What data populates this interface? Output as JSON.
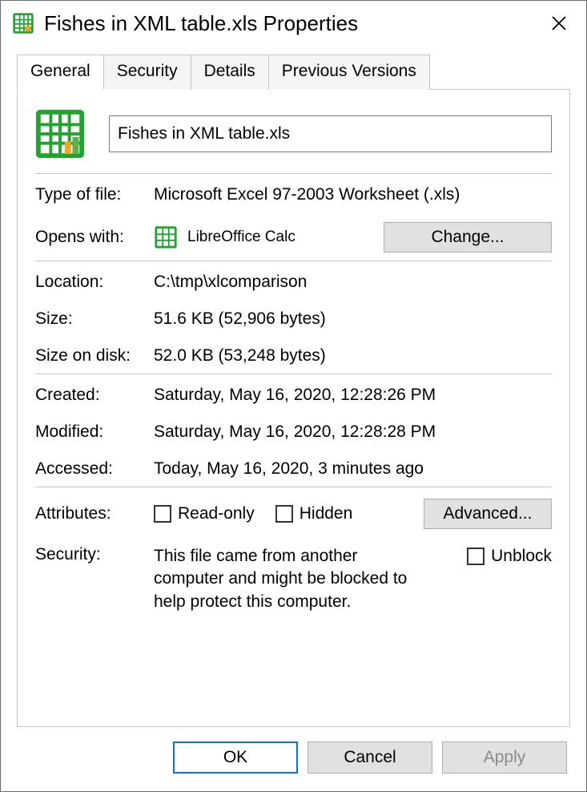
{
  "window": {
    "title": "Fishes in XML table.xls Properties"
  },
  "tabs": [
    {
      "label": "General",
      "active": true
    },
    {
      "label": "Security",
      "active": false
    },
    {
      "label": "Details",
      "active": false
    },
    {
      "label": "Previous Versions",
      "active": false
    }
  ],
  "general": {
    "filename": "Fishes in XML table.xls",
    "type_label": "Type of file:",
    "type_value": "Microsoft Excel 97-2003 Worksheet (.xls)",
    "openswith_label": "Opens with:",
    "openswith_app": "LibreOffice Calc",
    "change_label": "Change...",
    "location_label": "Location:",
    "location_value": "C:\\tmp\\xlcomparison",
    "size_label": "Size:",
    "size_value": "51.6 KB (52,906 bytes)",
    "sizeondisk_label": "Size on disk:",
    "sizeondisk_value": "52.0 KB (53,248 bytes)",
    "created_label": "Created:",
    "created_value": "Saturday, May 16, 2020, 12:28:26 PM",
    "modified_label": "Modified:",
    "modified_value": "Saturday, May 16, 2020, 12:28:28 PM",
    "accessed_label": "Accessed:",
    "accessed_value": "Today, May 16, 2020, 3 minutes ago",
    "attributes_label": "Attributes:",
    "readonly_label": "Read-only",
    "hidden_label": "Hidden",
    "advanced_label": "Advanced...",
    "security_label": "Security:",
    "security_text": "This file came from another computer and might be blocked to help protect this computer.",
    "unblock_label": "Unblock"
  },
  "footer": {
    "ok": "OK",
    "cancel": "Cancel",
    "apply": "Apply"
  }
}
